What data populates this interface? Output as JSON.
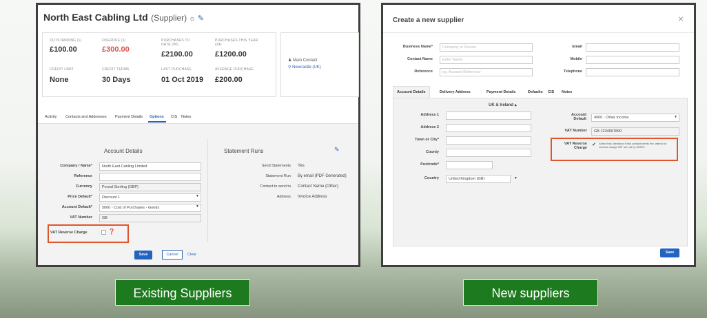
{
  "existing": {
    "title": "North East Cabling Ltd",
    "title_suffix": "(Supplier)",
    "stats": [
      {
        "label": "OUTSTANDING (1)",
        "value": "£100.00"
      },
      {
        "label": "OVERDUE (1)",
        "value": "£300.00"
      },
      {
        "label": "PURCHASES TO DATE (90)",
        "value": "£2100.00"
      },
      {
        "label": "PURCHASES THIS YEAR (24)",
        "value": "£1200.00"
      },
      {
        "label": "CREDIT LIMIT",
        "value": "None"
      },
      {
        "label": "CREDIT TERMS",
        "value": "30 Days"
      },
      {
        "label": "LAST PURCHASE",
        "value": "01 Oct 2019"
      },
      {
        "label": "AVERAGE PURCHASE",
        "value": "£200.00"
      }
    ],
    "main_contact": "Main Contact",
    "location": "Newcastle (UK)",
    "tabs": [
      "Activity",
      "Contacts and Addresses",
      "Payment Details",
      "Options",
      "CIS",
      "Notes"
    ],
    "active_tab": "Options",
    "account_details": {
      "heading": "Account Details",
      "fields": [
        {
          "label": "Company / Name*",
          "value": "North East Cabling Limited"
        },
        {
          "label": "Reference",
          "value": ""
        },
        {
          "label": "Currency",
          "value": "Pound Sterling (GBP)"
        },
        {
          "label": "Price Default*",
          "value": "Discount 1"
        },
        {
          "label": "Account Default*",
          "value": "5000 - Cost of Purchases - Goods"
        },
        {
          "label": "VAT Number",
          "value": "GB"
        }
      ],
      "vat_reverse_label": "VAT Reverse Charge"
    },
    "statement_runs": {
      "heading": "Statement Runs",
      "rows": [
        {
          "label": "Send Statements",
          "value": "Yes"
        },
        {
          "label": "Statement Run",
          "value": "By email (PDF Generated)"
        },
        {
          "label": "Contact to send to",
          "value": "Contact Name (Other)"
        },
        {
          "label": "Address",
          "value": "Invoice Address"
        }
      ]
    },
    "buttons": {
      "save": "Save",
      "cancel": "Cancel",
      "clear": "Clear"
    }
  },
  "new": {
    "title": "Create a new supplier",
    "close": "×",
    "top_fields": [
      {
        "label": "Business Name*",
        "placeholder": "Company or Person"
      },
      {
        "label": "Contact Name",
        "placeholder": "Enter Name"
      },
      {
        "label": "Reference",
        "placeholder": "eg. Account Reference"
      }
    ],
    "top_right_fields": [
      {
        "label": "Email"
      },
      {
        "label": "Mobile"
      },
      {
        "label": "Telephone"
      }
    ],
    "tabs": [
      "Account Details",
      "Delivery Address",
      "Payment Details",
      "Defaults",
      "CIS",
      "Notes"
    ],
    "region": "UK & Ireland",
    "address_fields": [
      {
        "label": "Address 1"
      },
      {
        "label": "Address 2"
      },
      {
        "label": "Town or City*"
      },
      {
        "label": "County"
      },
      {
        "label": "Postcode*"
      }
    ],
    "country": {
      "label": "Country",
      "value": "United Kingdom (GB)"
    },
    "account_default": {
      "label": "Account Default",
      "value": "4900 - Other Income"
    },
    "vat_number": {
      "label": "VAT Number",
      "value": "GB 1234567890"
    },
    "vat_reverse": {
      "label": "VAT Reverse Charge",
      "hint": "Select this checkbox if this contact meets the criteria for reverse charge VAT set out by HMRC."
    },
    "save": "Save"
  },
  "captions": {
    "left": "Existing Suppliers",
    "right": "New suppliers"
  }
}
